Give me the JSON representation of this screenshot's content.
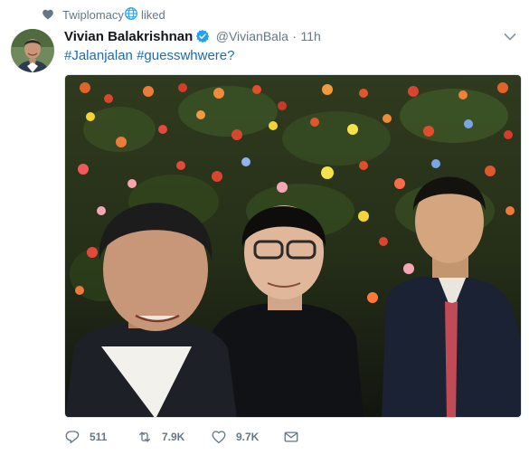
{
  "context": {
    "account": "Twiplomacy",
    "action": "liked",
    "icons": [
      "heart-icon",
      "globe-icon"
    ]
  },
  "tweet": {
    "author_name": "Vivian Balakrishnan",
    "handle": "@VivianBala",
    "separator": "·",
    "time": "11h",
    "verified": true,
    "hashtags": [
      "#Jalanjalan",
      "#guesswhwere?"
    ]
  },
  "actions": {
    "reply_count": "511",
    "retweet_count": "7.9K",
    "like_count": "9.7K",
    "icons": [
      "reply-icon",
      "retweet-icon",
      "like-icon",
      "message-icon"
    ]
  },
  "colors": {
    "link": "#1b6dab",
    "muted": "#657786",
    "verified": "#1da1f2",
    "text": "#14171a"
  }
}
